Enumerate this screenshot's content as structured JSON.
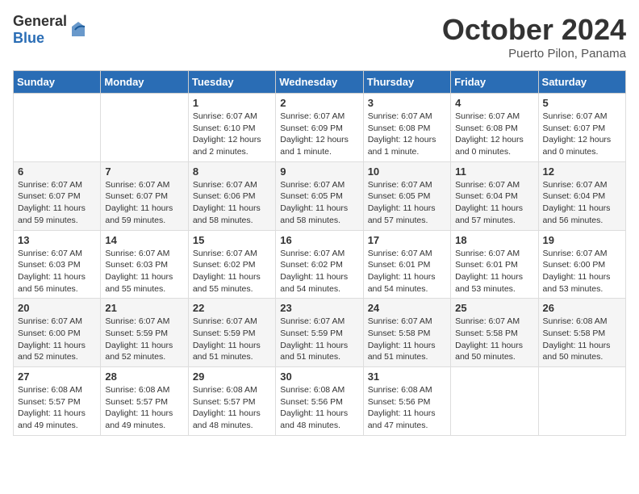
{
  "header": {
    "logo_general": "General",
    "logo_blue": "Blue",
    "title": "October 2024",
    "location": "Puerto Pilon, Panama"
  },
  "days_of_week": [
    "Sunday",
    "Monday",
    "Tuesday",
    "Wednesday",
    "Thursday",
    "Friday",
    "Saturday"
  ],
  "weeks": [
    [
      {
        "day": "",
        "info": ""
      },
      {
        "day": "",
        "info": ""
      },
      {
        "day": "1",
        "info": "Sunrise: 6:07 AM\nSunset: 6:10 PM\nDaylight: 12 hours\nand 2 minutes."
      },
      {
        "day": "2",
        "info": "Sunrise: 6:07 AM\nSunset: 6:09 PM\nDaylight: 12 hours\nand 1 minute."
      },
      {
        "day": "3",
        "info": "Sunrise: 6:07 AM\nSunset: 6:08 PM\nDaylight: 12 hours\nand 1 minute."
      },
      {
        "day": "4",
        "info": "Sunrise: 6:07 AM\nSunset: 6:08 PM\nDaylight: 12 hours\nand 0 minutes."
      },
      {
        "day": "5",
        "info": "Sunrise: 6:07 AM\nSunset: 6:07 PM\nDaylight: 12 hours\nand 0 minutes."
      }
    ],
    [
      {
        "day": "6",
        "info": "Sunrise: 6:07 AM\nSunset: 6:07 PM\nDaylight: 11 hours\nand 59 minutes."
      },
      {
        "day": "7",
        "info": "Sunrise: 6:07 AM\nSunset: 6:07 PM\nDaylight: 11 hours\nand 59 minutes."
      },
      {
        "day": "8",
        "info": "Sunrise: 6:07 AM\nSunset: 6:06 PM\nDaylight: 11 hours\nand 58 minutes."
      },
      {
        "day": "9",
        "info": "Sunrise: 6:07 AM\nSunset: 6:05 PM\nDaylight: 11 hours\nand 58 minutes."
      },
      {
        "day": "10",
        "info": "Sunrise: 6:07 AM\nSunset: 6:05 PM\nDaylight: 11 hours\nand 57 minutes."
      },
      {
        "day": "11",
        "info": "Sunrise: 6:07 AM\nSunset: 6:04 PM\nDaylight: 11 hours\nand 57 minutes."
      },
      {
        "day": "12",
        "info": "Sunrise: 6:07 AM\nSunset: 6:04 PM\nDaylight: 11 hours\nand 56 minutes."
      }
    ],
    [
      {
        "day": "13",
        "info": "Sunrise: 6:07 AM\nSunset: 6:03 PM\nDaylight: 11 hours\nand 56 minutes."
      },
      {
        "day": "14",
        "info": "Sunrise: 6:07 AM\nSunset: 6:03 PM\nDaylight: 11 hours\nand 55 minutes."
      },
      {
        "day": "15",
        "info": "Sunrise: 6:07 AM\nSunset: 6:02 PM\nDaylight: 11 hours\nand 55 minutes."
      },
      {
        "day": "16",
        "info": "Sunrise: 6:07 AM\nSunset: 6:02 PM\nDaylight: 11 hours\nand 54 minutes."
      },
      {
        "day": "17",
        "info": "Sunrise: 6:07 AM\nSunset: 6:01 PM\nDaylight: 11 hours\nand 54 minutes."
      },
      {
        "day": "18",
        "info": "Sunrise: 6:07 AM\nSunset: 6:01 PM\nDaylight: 11 hours\nand 53 minutes."
      },
      {
        "day": "19",
        "info": "Sunrise: 6:07 AM\nSunset: 6:00 PM\nDaylight: 11 hours\nand 53 minutes."
      }
    ],
    [
      {
        "day": "20",
        "info": "Sunrise: 6:07 AM\nSunset: 6:00 PM\nDaylight: 11 hours\nand 52 minutes."
      },
      {
        "day": "21",
        "info": "Sunrise: 6:07 AM\nSunset: 5:59 PM\nDaylight: 11 hours\nand 52 minutes."
      },
      {
        "day": "22",
        "info": "Sunrise: 6:07 AM\nSunset: 5:59 PM\nDaylight: 11 hours\nand 51 minutes."
      },
      {
        "day": "23",
        "info": "Sunrise: 6:07 AM\nSunset: 5:59 PM\nDaylight: 11 hours\nand 51 minutes."
      },
      {
        "day": "24",
        "info": "Sunrise: 6:07 AM\nSunset: 5:58 PM\nDaylight: 11 hours\nand 51 minutes."
      },
      {
        "day": "25",
        "info": "Sunrise: 6:07 AM\nSunset: 5:58 PM\nDaylight: 11 hours\nand 50 minutes."
      },
      {
        "day": "26",
        "info": "Sunrise: 6:08 AM\nSunset: 5:58 PM\nDaylight: 11 hours\nand 50 minutes."
      }
    ],
    [
      {
        "day": "27",
        "info": "Sunrise: 6:08 AM\nSunset: 5:57 PM\nDaylight: 11 hours\nand 49 minutes."
      },
      {
        "day": "28",
        "info": "Sunrise: 6:08 AM\nSunset: 5:57 PM\nDaylight: 11 hours\nand 49 minutes."
      },
      {
        "day": "29",
        "info": "Sunrise: 6:08 AM\nSunset: 5:57 PM\nDaylight: 11 hours\nand 48 minutes."
      },
      {
        "day": "30",
        "info": "Sunrise: 6:08 AM\nSunset: 5:56 PM\nDaylight: 11 hours\nand 48 minutes."
      },
      {
        "day": "31",
        "info": "Sunrise: 6:08 AM\nSunset: 5:56 PM\nDaylight: 11 hours\nand 47 minutes."
      },
      {
        "day": "",
        "info": ""
      },
      {
        "day": "",
        "info": ""
      }
    ]
  ]
}
